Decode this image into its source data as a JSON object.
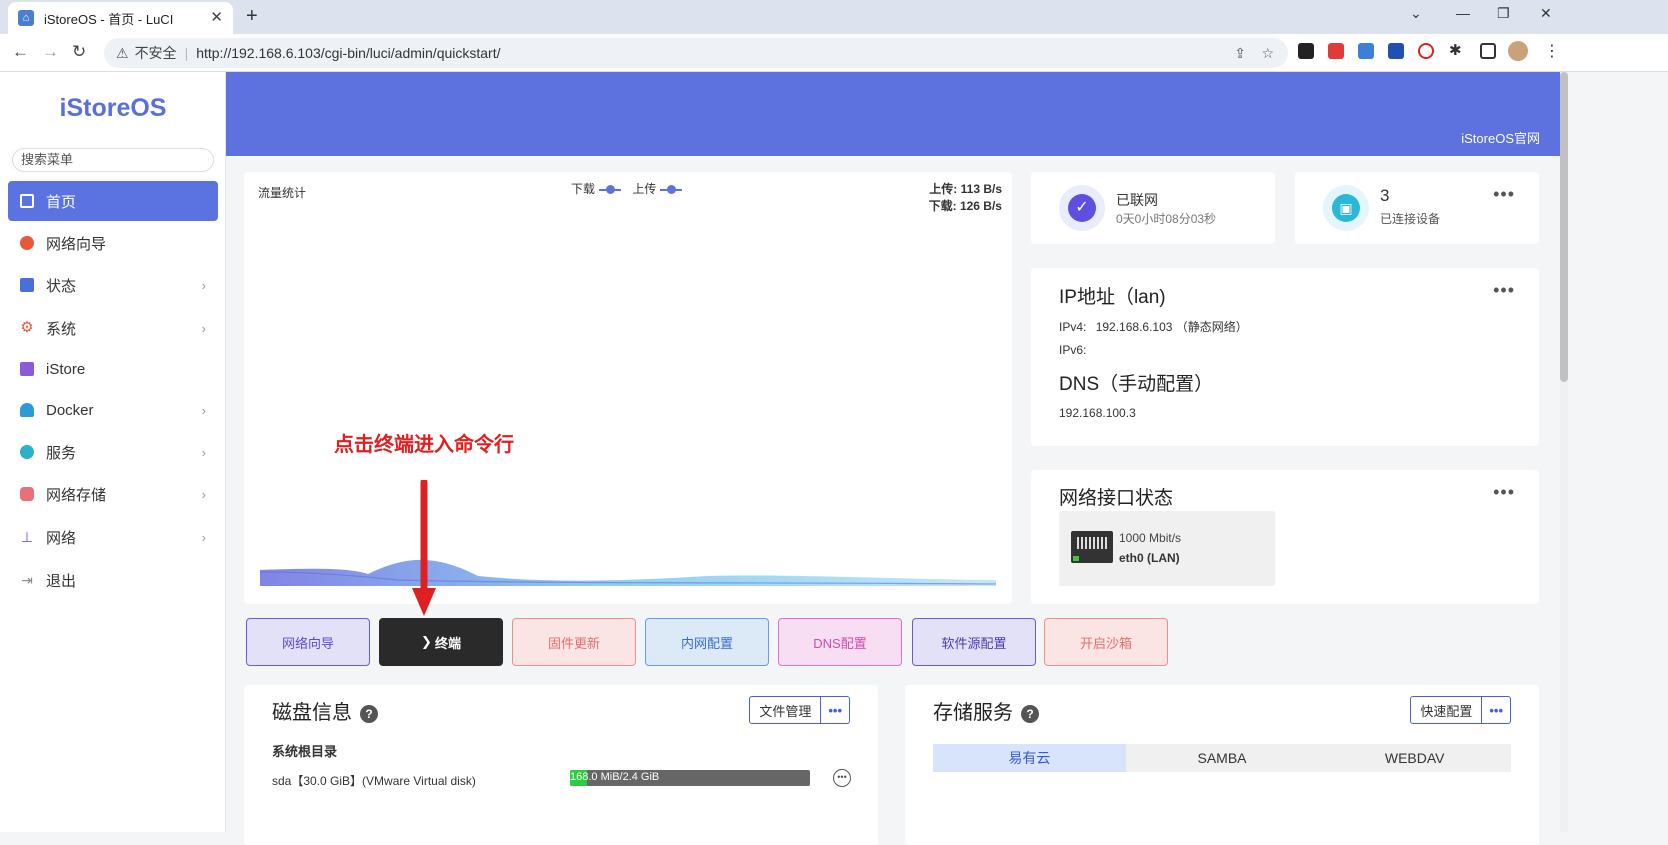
{
  "browser": {
    "tab_title": "iStoreOS - 首页 - LuCI",
    "insecure_label": "不安全",
    "url": "http://192.168.6.103/cgi-bin/luci/admin/quickstart/"
  },
  "sidebar": {
    "logo": "iStoreOS",
    "search_placeholder": "搜索菜单",
    "items": [
      {
        "label": "首页",
        "icon": "dashboard-icon",
        "active": true
      },
      {
        "label": "网络向导",
        "icon": "globe-icon"
      },
      {
        "label": "状态",
        "icon": "grid-icon"
      },
      {
        "label": "系统",
        "icon": "gear-icon"
      },
      {
        "label": "iStore",
        "icon": "bag-icon"
      },
      {
        "label": "Docker",
        "icon": "docker-icon"
      },
      {
        "label": "服务",
        "icon": "puzzle-icon"
      },
      {
        "label": "网络存储",
        "icon": "database-icon"
      },
      {
        "label": "网络",
        "icon": "network-icon"
      },
      {
        "label": "退出",
        "icon": "logout-icon"
      }
    ]
  },
  "banner": {
    "link": "iStoreOS官网"
  },
  "traffic": {
    "title": "流量统计",
    "legend_download": "下载",
    "legend_upload": "上传",
    "upload_rate": "上传: 113 B/s",
    "download_rate": "下载: 126 B/s"
  },
  "annotation": "点击终端进入命令行",
  "network_status": {
    "label": "已联网",
    "uptime": "0天0小时08分03秒"
  },
  "devices": {
    "count": "3",
    "label": "已连接设备"
  },
  "ip_card": {
    "title": "IP地址（lan)",
    "ipv4_label": "IPv4:",
    "ipv4_value": "192.168.6.103 （静态网络）",
    "ipv6_label": "IPv6:",
    "dns_title": "DNS（手动配置）",
    "dns_value": "192.168.100.3"
  },
  "interface_card": {
    "title": "网络接口状态",
    "speed": "1000 Mbit/s",
    "name": "eth0 (LAN)"
  },
  "quick_buttons": [
    "网络向导",
    "终端",
    "固件更新",
    "内网配置",
    "DNS配置",
    "软件源配置",
    "开启沙箱"
  ],
  "disk_card": {
    "title": "磁盘信息",
    "manage_button": "文件管理",
    "section": "系统根目录",
    "disk_name": "sda【30.0 GiB】(VMware Virtual disk)",
    "usage_text": "168.0 MiB/2.4 GiB",
    "usage_fraction": 0.07
  },
  "storage_card": {
    "title": "存储服务",
    "config_button": "快速配置",
    "tabs": [
      "易有云",
      "SAMBA",
      "WEBDAV"
    ]
  },
  "colors": {
    "accent": "#5d72de",
    "annotation": "#e02020"
  }
}
